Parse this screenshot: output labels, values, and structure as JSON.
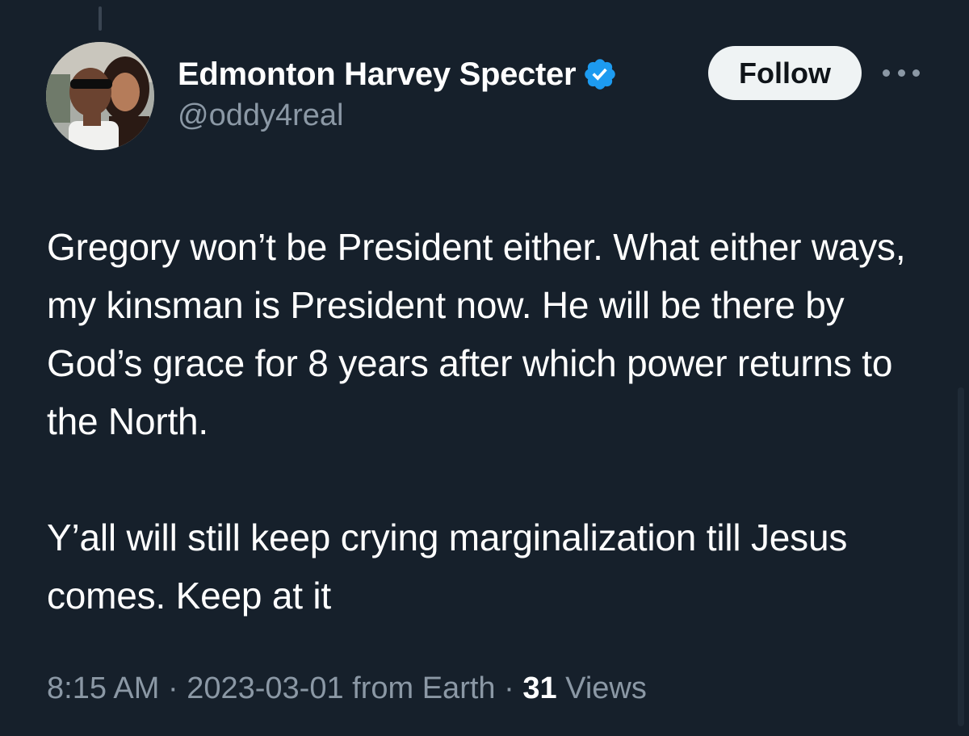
{
  "tweet": {
    "author": {
      "display_name": "Edmonton Harvey Specter",
      "handle": "@oddy4real",
      "verified": true,
      "verified_badge_color": "#1d9bf0"
    },
    "follow_label": "Follow",
    "more_icon": "more-horizontal-icon",
    "text_paragraphs": [
      "Gregory won’t be President either. What either ways, my kinsman is President now. He will be there by God’s grace for 8 years after which power returns to the North.",
      "Y’all will still keep crying marginalization till Jesus comes. Keep at it"
    ],
    "meta": {
      "time": "8:15 AM",
      "separator": " · ",
      "date": "2023-03-01",
      "source": "from Earth",
      "views_count": "31",
      "views_label": "Views"
    }
  },
  "colors": {
    "background": "#16202b",
    "text_primary": "#ffffff",
    "text_secondary": "#8b98a5",
    "button_bg": "#eff3f4",
    "button_text": "#0f1419"
  }
}
